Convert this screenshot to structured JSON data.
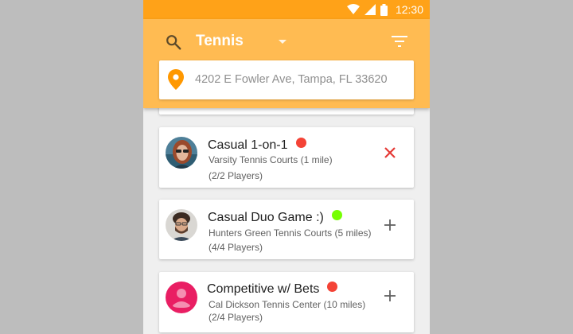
{
  "status_bar": {
    "time": "12:30"
  },
  "header": {
    "sport": "Tennis",
    "location": "4202 E Fowler Ave, Tampa, FL 33620"
  },
  "games": [
    {
      "title": "Casual 1-on-1",
      "status_color": "#f44336",
      "court": "Varsity Tennis Courts (1 mile)",
      "players": "(2/2 Players)",
      "action": "close-icon",
      "action_color": "#e53935"
    },
    {
      "title": "Casual Duo Game :)",
      "status_color": "#76ff03",
      "court": "Hunters Green Tennis Courts (5 miles)",
      "players": "(4/4 Players)",
      "action": "add-icon",
      "action_color": "#616161"
    },
    {
      "title": "Competitive w/ Bets",
      "status_color": "#f44336",
      "court": "Cal Dickson Tennis Center (10 miles)",
      "players": "(2/4 Players)",
      "action": "add-icon",
      "action_color": "#616161"
    }
  ],
  "colors": {
    "status_bar": "#ffa218",
    "app_bar": "#ffbb52",
    "accent_pin": "#ff9800",
    "avatar_placeholder": "#e91e63"
  }
}
